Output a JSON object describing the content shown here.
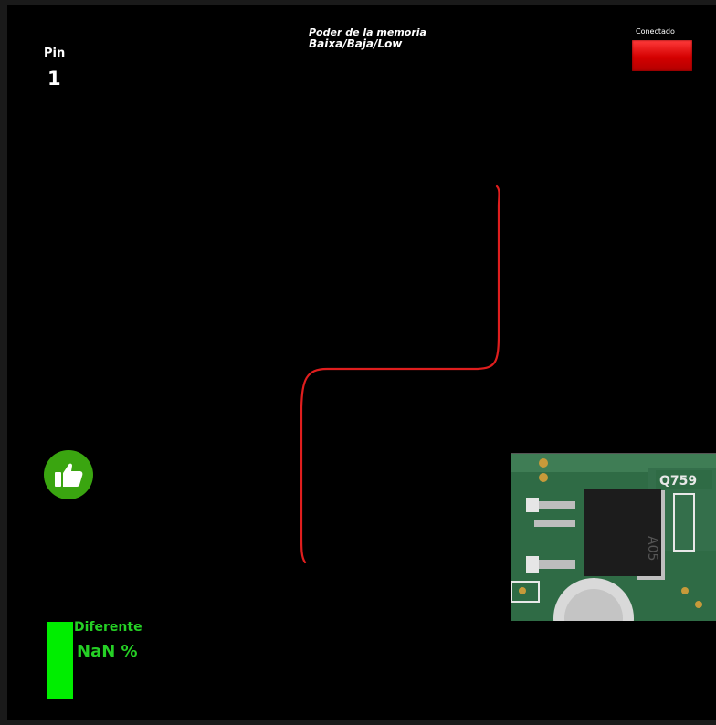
{
  "pin": {
    "label": "Pin",
    "value": "1"
  },
  "title": {
    "line1": "Poder de la memoria",
    "line2": "Baixa/Baja/Low"
  },
  "connection": {
    "label": "Conectado",
    "status_color": "#e00000"
  },
  "action": {
    "icon": "thumbs-up-icon",
    "color": "#3aa510"
  },
  "difference": {
    "label": "Diferente",
    "value": "NaN %",
    "color": "#00ee00"
  },
  "waveform": {
    "color": "#e01e1e"
  },
  "component_photo": {
    "chip_marking": "A05",
    "silkscreen": "Q759"
  }
}
